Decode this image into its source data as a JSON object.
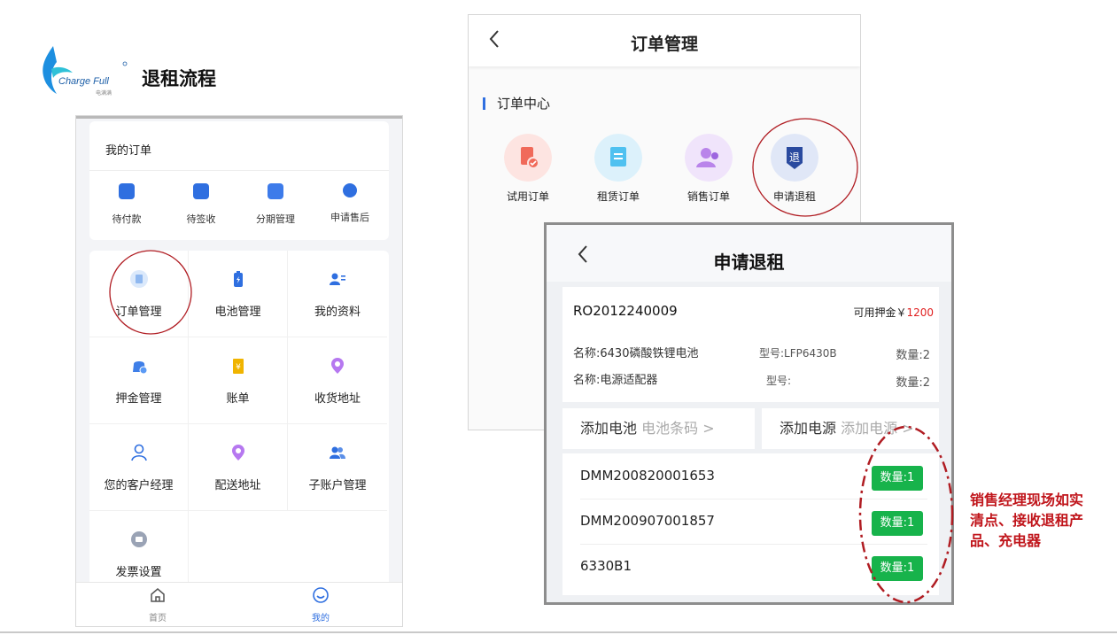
{
  "slide": {
    "title": "退租流程",
    "logo_text": "Charge Full",
    "logo_sub": "电满满",
    "note": "销售经理现场如实清点、接收退租产品、充电器",
    "accent_red": "#c0151b"
  },
  "my_page": {
    "orders_title": "我的订单",
    "order_items": [
      {
        "label": "待付款",
        "icon": "wallet-icon"
      },
      {
        "label": "待签收",
        "icon": "package-icon"
      },
      {
        "label": "分期管理",
        "icon": "installment-icon"
      },
      {
        "label": "申请售后",
        "icon": "after-sale-icon"
      }
    ],
    "grid": [
      {
        "label": "订单管理",
        "icon": "order-doc-icon"
      },
      {
        "label": "电池管理",
        "icon": "battery-icon"
      },
      {
        "label": "我的资料",
        "icon": "profile-icon"
      },
      {
        "label": "押金管理",
        "icon": "deposit-bag-icon"
      },
      {
        "label": "账单",
        "icon": "bill-icon"
      },
      {
        "label": "收货地址",
        "icon": "location-pin-icon"
      },
      {
        "label": "您的客户经理",
        "icon": "person-icon"
      },
      {
        "label": "配送地址",
        "icon": "location-pin-icon"
      },
      {
        "label": "子账户管理",
        "icon": "users-icon"
      },
      {
        "label": "发票设置",
        "icon": "invoice-icon"
      }
    ],
    "tabs": [
      {
        "label": "首页",
        "icon": "home-icon",
        "active": false
      },
      {
        "label": "我的",
        "icon": "smile-icon",
        "active": true
      }
    ],
    "active_color": "#2f6fe0"
  },
  "order_mgmt": {
    "title": "订单管理",
    "section": "订单中心",
    "items": [
      {
        "label": "试用订单",
        "icon": "trial-order-icon"
      },
      {
        "label": "租赁订单",
        "icon": "lease-order-icon"
      },
      {
        "label": "销售订单",
        "icon": "sales-order-icon"
      },
      {
        "label": "申请退租",
        "icon": "return-lease-icon"
      }
    ]
  },
  "apply_return": {
    "title": "申请退租",
    "order_no": "RO2012240009",
    "deposit_label": "可用押金￥",
    "deposit_amount": "1200",
    "rows": [
      {
        "name": "名称:6430磷酸铁锂电池",
        "model": "型号:LFP6430B",
        "qty": "数量:2"
      },
      {
        "name": "名称:电源适配器",
        "model": "型号:",
        "qty": "数量:2"
      }
    ],
    "add_battery": {
      "label": "添加电池",
      "hint": "电池条码 >"
    },
    "add_power": {
      "label": "添加电源",
      "hint": "添加电源 >"
    },
    "list": [
      {
        "code": "DMM200820001653",
        "qty": "数量:1"
      },
      {
        "code": "DMM200907001857",
        "qty": "数量:1"
      },
      {
        "code": "6330B1",
        "qty": "数量:1"
      }
    ],
    "badge_color": "#17b34b"
  }
}
